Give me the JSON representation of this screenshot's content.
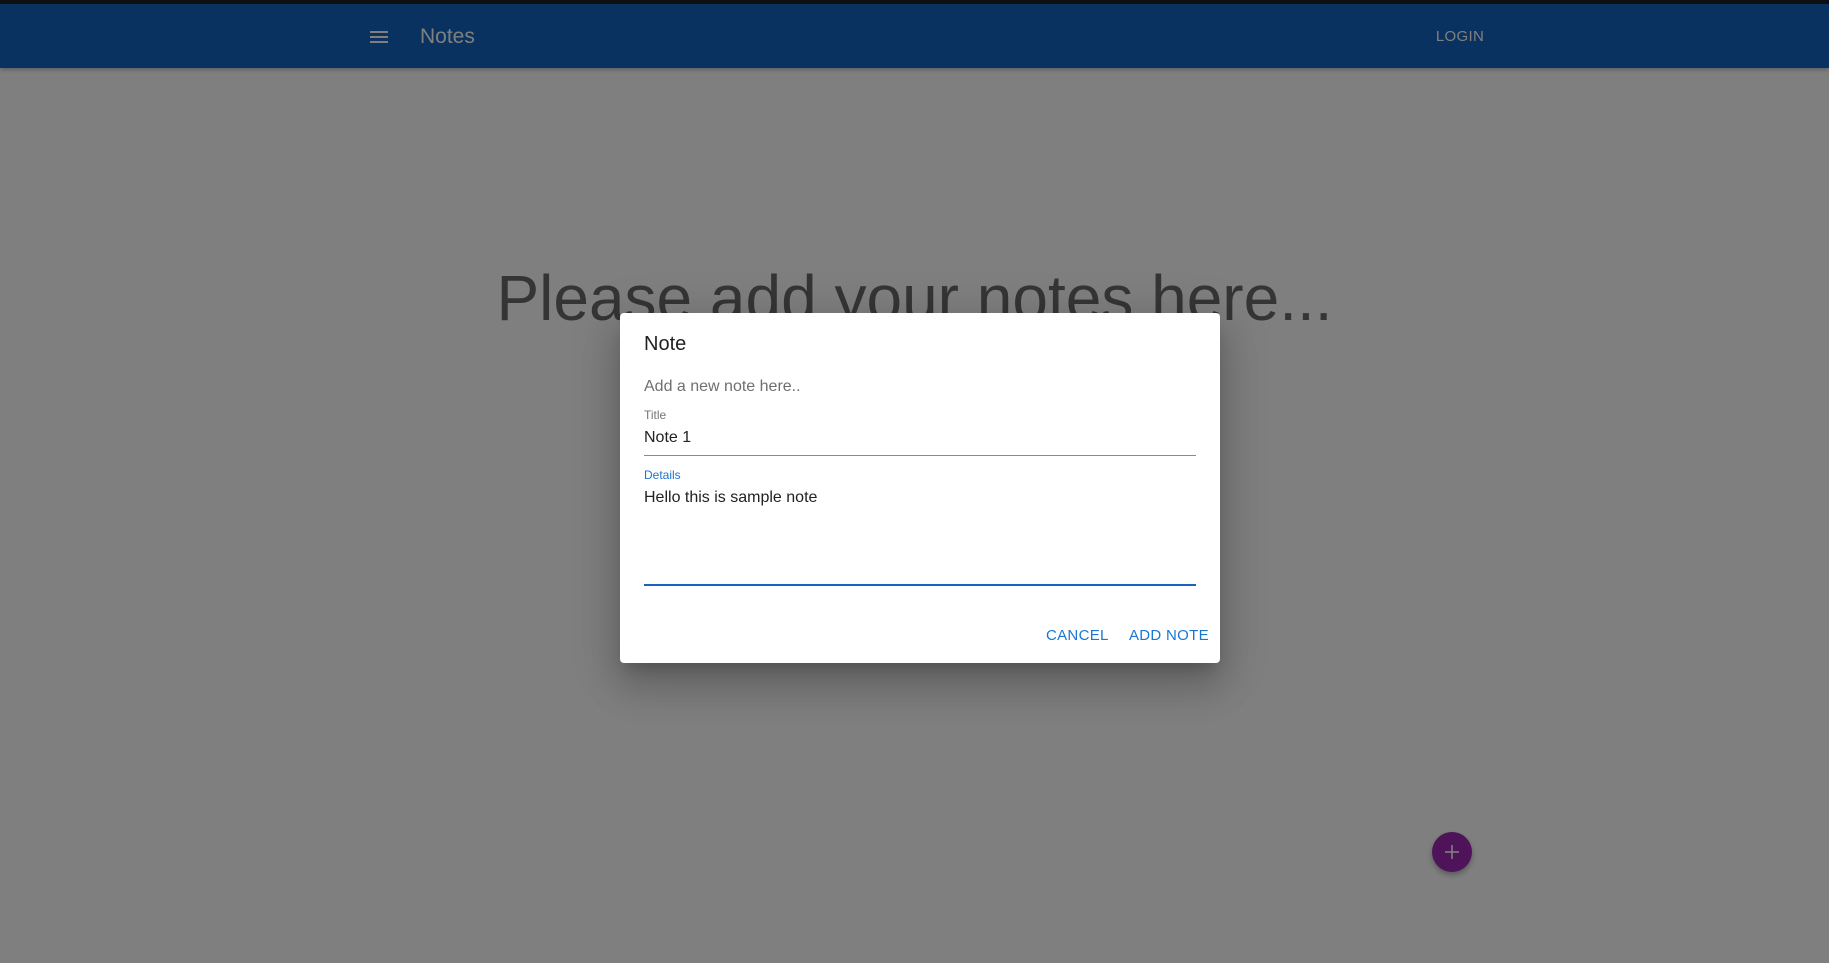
{
  "appbar": {
    "menu_icon": "menu-icon",
    "title": "Notes",
    "login_label": "LOGIN",
    "color": "#1565c0"
  },
  "main": {
    "empty_message": "Please add your notes here...",
    "fab_icon": "plus-icon",
    "fab_color": "#9c27b0"
  },
  "dialog": {
    "title": "Note",
    "subtitle": "Add a new note here..",
    "fields": {
      "title": {
        "label": "Title",
        "value": "Note 1"
      },
      "details": {
        "label": "Details",
        "value": "Hello this is sample note"
      }
    },
    "buttons": {
      "cancel": "CANCEL",
      "add_note": "ADD NOTE"
    },
    "accent_color": "#1976d2"
  }
}
